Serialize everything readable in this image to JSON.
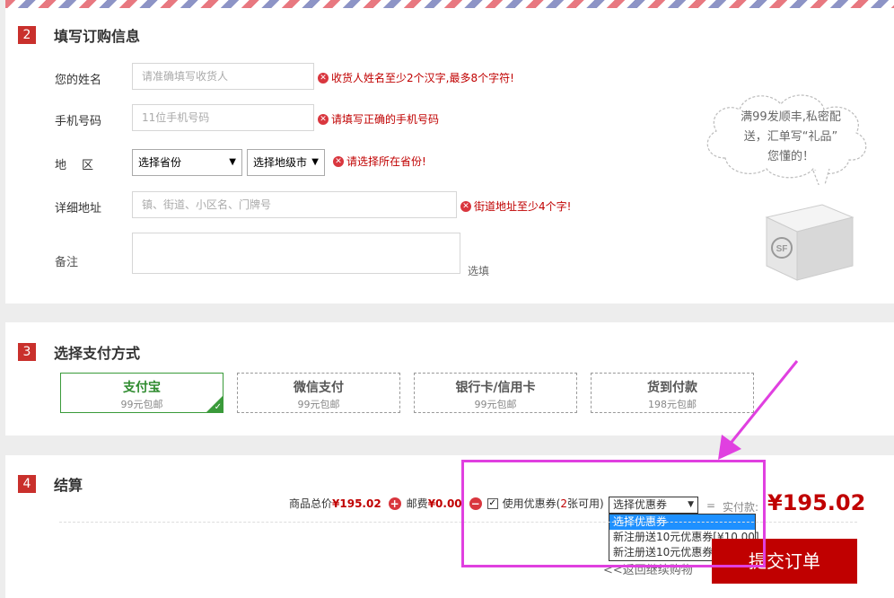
{
  "order_section": {
    "number": "2",
    "title": "填写订购信息",
    "name": {
      "label": "您的姓名",
      "placeholder": "请准确填写收货人",
      "error": "收货人姓名至少2个汉字,最多8个字符!"
    },
    "phone": {
      "label": "手机号码",
      "placeholder": "11位手机号码",
      "error": "请填写正确的手机号码"
    },
    "region": {
      "label": "地　区",
      "province": "选择省份",
      "city": "选择地级市",
      "error": "请选择所在省份!"
    },
    "address": {
      "label": "详细地址",
      "placeholder": "镇、街道、小区名、门牌号",
      "error": "街道地址至少4个字!"
    },
    "note": {
      "label": "备注",
      "hint": "选填"
    },
    "promo": {
      "line1": "满99发顺丰,私密配",
      "line2": "送，汇单写“礼品”",
      "line3": "您懂的！",
      "box_logo": "SF"
    }
  },
  "pay_section": {
    "number": "3",
    "title": "选择支付方式",
    "options": [
      {
        "name": "支付宝",
        "sub": "99元包邮",
        "selected": true
      },
      {
        "name": "微信支付",
        "sub": "99元包邮",
        "selected": false
      },
      {
        "name": "银行卡/信用卡",
        "sub": "99元包邮",
        "selected": false
      },
      {
        "name": "货到付款",
        "sub": "198元包邮",
        "selected": false
      }
    ]
  },
  "settle_section": {
    "number": "4",
    "title": "结算",
    "goods_label": "商品总价",
    "goods_value": "¥195.02",
    "shipping_label": "邮费",
    "shipping_value": "¥0.00",
    "coupon_label_pre": "使用优惠券(",
    "coupon_count": "2",
    "coupon_label_post": "张可用)",
    "coupon_selected": "选择优惠券",
    "coupon_options": [
      "选择优惠券",
      "新注册送10元优惠券[¥10.00]",
      "新注册送10元优惠券[¥10.00]"
    ],
    "equals": "=",
    "pay_label": "实付款:",
    "grand_total": "¥195.02",
    "submit_label": "提交订单",
    "back_label": "<<返回继续购物"
  },
  "colors": {
    "accent_red": "#c00000",
    "section_badge": "#c9302c",
    "selected_green": "#3a9a3a",
    "annotation_magenta": "#e040e0",
    "dropdown_highlight": "#1e90ff"
  }
}
